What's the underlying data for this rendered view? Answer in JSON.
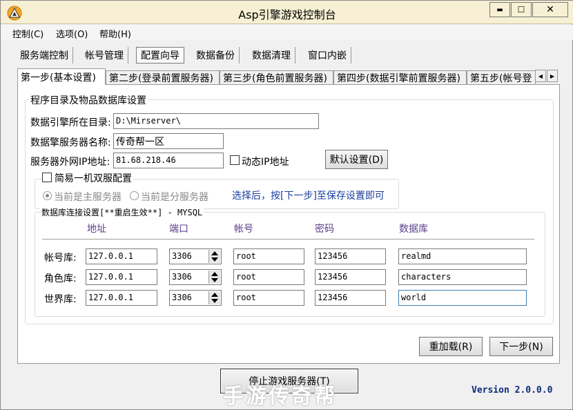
{
  "window": {
    "title": "Asp引擎游戏控制台",
    "minimize_glyph": "▬",
    "maximize_glyph": "☐",
    "close_glyph": "✕"
  },
  "menu": {
    "items": [
      "控制(C)",
      "选项(O)",
      "帮助(H)"
    ]
  },
  "nav": {
    "items": [
      "服务端控制",
      "帐号管理",
      "配置向导",
      "数据备份",
      "数据清理",
      "窗口内嵌"
    ],
    "active_index": 2
  },
  "tabs": {
    "items": [
      "第一步(基本设置)",
      "第二步(登录前置服务器)",
      "第三步(角色前置服务器)",
      "第四步(数据引擎前置服务器)",
      "第五步(帐号登"
    ],
    "active_index": 0,
    "scroll_left": "◀",
    "scroll_right": "▶"
  },
  "basic": {
    "group_title": "程序目录及物品数据库设置",
    "dir_label": "数据引擎所在目录:",
    "dir_value": "D:\\Mirserver\\",
    "server_name_label": "数据擎服务器名称:",
    "server_name_value": "传奇帮一区",
    "ip_label": "服务器外网IP地址:",
    "ip_value": "81.68.218.46",
    "dynamic_ip_label": "动态IP地址",
    "dynamic_ip_checked": false,
    "default_button": "默认设置(D)"
  },
  "dual": {
    "label": "简易一机双服配置",
    "checked": false,
    "main_server_label": "当前是主服务器",
    "sub_server_label": "当前是分服务器",
    "selected": "main",
    "hint": "选择后，按[下一步]至保存设置即可"
  },
  "db": {
    "group_title": "数据库连接设置[**重启生效**] - MYSQL",
    "headers": [
      "地址",
      "端口",
      "帐号",
      "密码",
      "数据库"
    ],
    "rows": [
      {
        "label": "帐号库:",
        "address": "127.0.0.1",
        "port": "3306",
        "user": "root",
        "password": "123456",
        "database": "realmd"
      },
      {
        "label": "角色库:",
        "address": "127.0.0.1",
        "port": "3306",
        "user": "root",
        "password": "123456",
        "database": "characters"
      },
      {
        "label": "世界库:",
        "address": "127.0.0.1",
        "port": "3306",
        "user": "root",
        "password": "123456",
        "database": "world"
      }
    ]
  },
  "buttons": {
    "reload": "重加载(R)",
    "next": "下一步(N)",
    "stop": "停止游戏服务器(T)"
  },
  "version": "Version 2.0.0.0",
  "watermark": "手游传奇帮"
}
